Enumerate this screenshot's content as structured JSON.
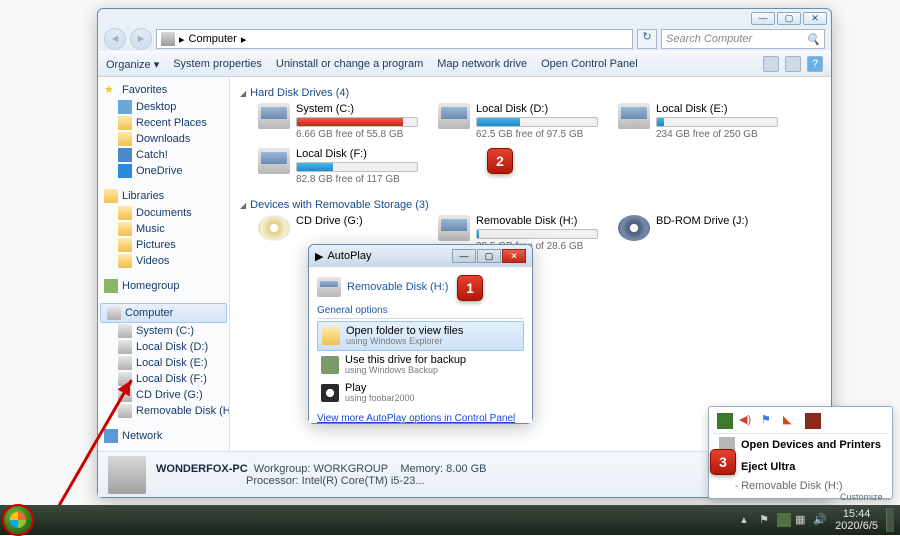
{
  "explorer": {
    "title_buttons": {
      "min": "—",
      "max": "▢",
      "close": "✕"
    },
    "breadcrumb": {
      "root": "Computer",
      "arrow": "▸"
    },
    "search_placeholder": "Search Computer",
    "toolbar": {
      "organize": "Organize ▾",
      "sys_props": "System properties",
      "uninstall": "Uninstall or change a program",
      "map": "Map network drive",
      "ctrl": "Open Control Panel"
    },
    "sections": {
      "hdd": {
        "title": "Hard Disk Drives (4)",
        "drives": [
          {
            "name": "System (C:)",
            "free": "6.66 GB free of 55.8 GB",
            "pct": 88,
            "warn": true
          },
          {
            "name": "Local Disk (D:)",
            "free": "62.5 GB free of 97.5 GB",
            "pct": 36
          },
          {
            "name": "Local Disk (E:)",
            "free": "234 GB free of 250 GB",
            "pct": 6
          },
          {
            "name": "Local Disk (F:)",
            "free": "82.8 GB free of 117 GB",
            "pct": 30
          }
        ]
      },
      "removable": {
        "title": "Devices with Removable Storage (3)",
        "drives": [
          {
            "name": "CD Drive (G:)",
            "type": "cd"
          },
          {
            "name": "Removable Disk (H:)",
            "free": "28.5 GB free of 28.6 GB",
            "pct": 2,
            "type": "hdd"
          },
          {
            "name": "BD-ROM Drive (J:)",
            "type": "bd"
          }
        ]
      }
    },
    "sidebar": {
      "favorites": {
        "label": "Favorites",
        "items": [
          "Desktop",
          "Recent Places",
          "Downloads",
          "Catch!",
          "OneDrive"
        ]
      },
      "libraries": {
        "label": "Libraries",
        "items": [
          "Documents",
          "Music",
          "Pictures",
          "Videos"
        ]
      },
      "homegroup": {
        "label": "Homegroup"
      },
      "computer": {
        "label": "Computer",
        "items": [
          "System (C:)",
          "Local Disk (D:)",
          "Local Disk (E:)",
          "Local Disk (F:)",
          "CD Drive (G:)",
          "Removable Disk (H:)"
        ]
      },
      "network": {
        "label": "Network"
      }
    },
    "details": {
      "name": "WONDERFOX-PC",
      "workgroup_l": "Workgroup:",
      "workgroup": "WORKGROUP",
      "mem_l": "Memory:",
      "mem": "8.00 GB",
      "proc_l": "Processor:",
      "proc": "Intel(R) Core(TM) i5-23..."
    }
  },
  "autoplay": {
    "title": "AutoPlay",
    "device": "Removable Disk (H:)",
    "section": "General options",
    "opts": [
      {
        "t": "Open folder to view files",
        "s": "using Windows Explorer",
        "sel": true,
        "ico": "folder"
      },
      {
        "t": "Use this drive for backup",
        "s": "using Windows Backup",
        "ico": "backup"
      },
      {
        "t": "Play",
        "s": "using foobar2000",
        "ico": "play"
      }
    ],
    "link": "View more AutoPlay options in Control Panel"
  },
  "eject": {
    "open": "Open Devices and Printers",
    "eject": "Eject Ultra",
    "sub": "Removable Disk (H:)",
    "customize": "Customize..."
  },
  "taskbar": {
    "time": "15:44",
    "date": "2020/6/5"
  },
  "badges": {
    "b1": "1",
    "b2": "2",
    "b3": "3"
  }
}
